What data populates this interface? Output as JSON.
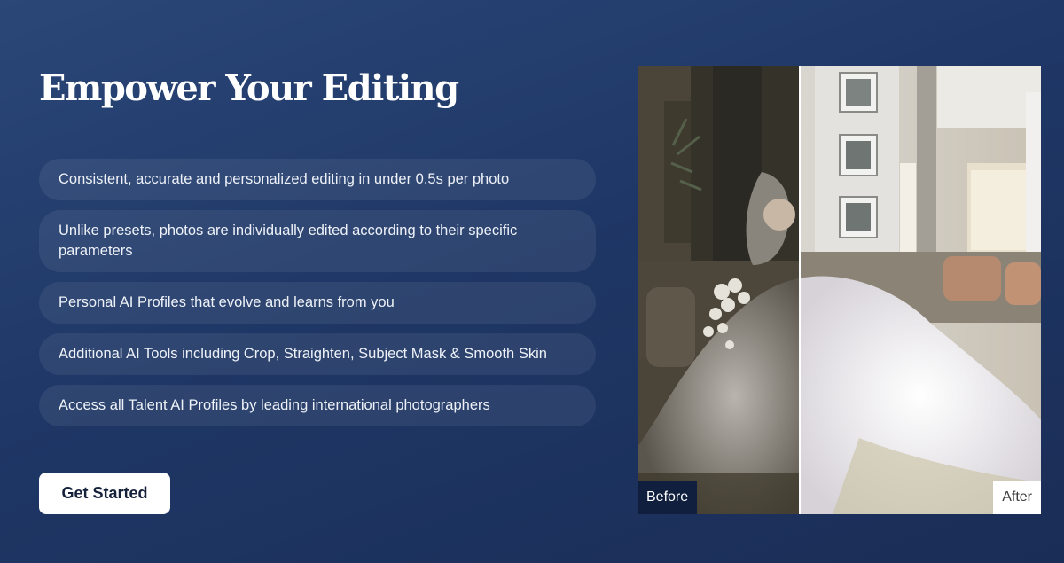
{
  "section": {
    "title": "Empower Your Editing"
  },
  "features": [
    "Consistent, accurate and personalized editing in under 0.5s per photo",
    "Unlike presets, photos are individually edited according to their specific parameters",
    "Personal AI Profiles that evolve and learns from you",
    "Additional AI Tools including Crop, Straighten, Subject Mask & Smooth Skin",
    "Access all Talent AI Profiles by leading international photographers"
  ],
  "cta": {
    "label": "Get Started"
  },
  "comparison": {
    "before_label": "Before",
    "after_label": "After"
  },
  "colors": {
    "background": "#1f3766",
    "button": "#ffffff",
    "before_tag": "#0f1f3d"
  }
}
